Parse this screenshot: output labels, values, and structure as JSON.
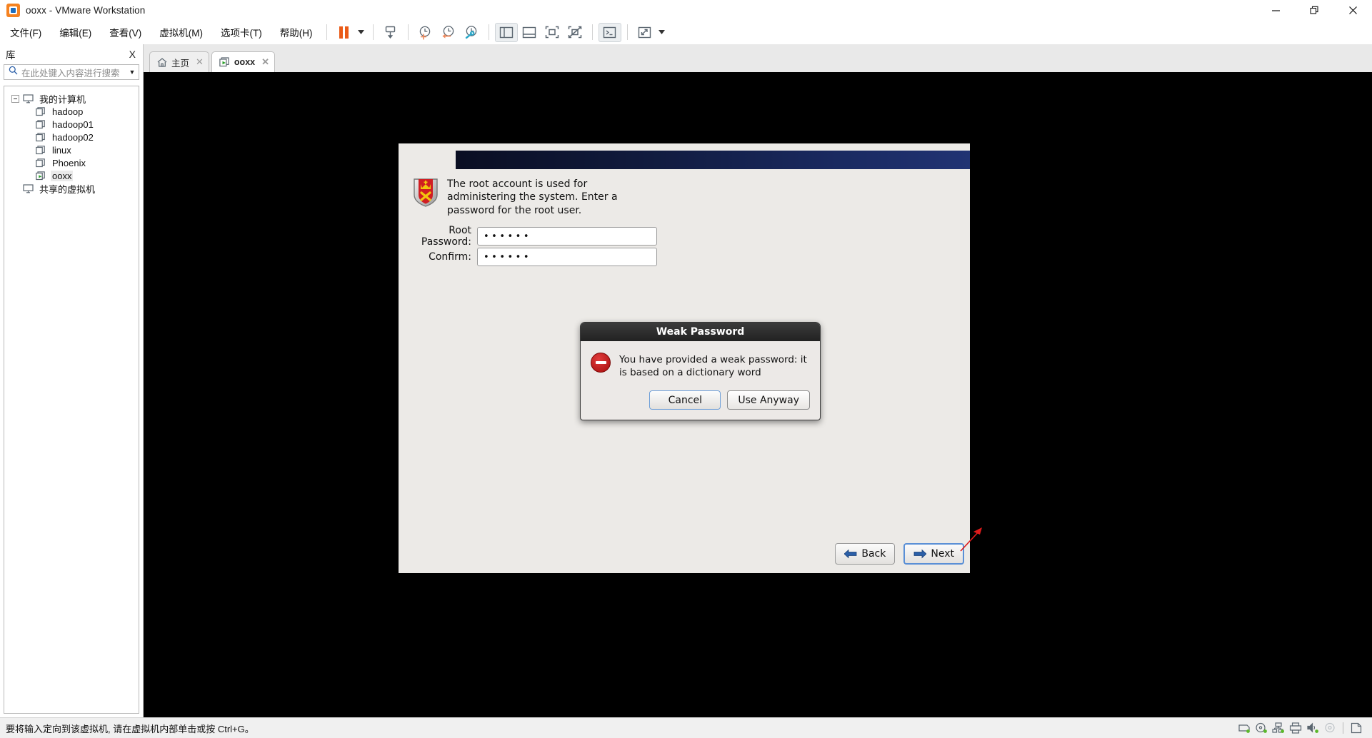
{
  "window": {
    "title": "ooxx - VMware Workstation",
    "app_icon": "vmware-logo-icon",
    "minimize": "minimize-icon",
    "restore": "restore-icon",
    "close": "close-icon"
  },
  "menubar": {
    "items": [
      {
        "label": "文件(F)",
        "text": "文件",
        "accel": "F"
      },
      {
        "label": "编辑(E)",
        "text": "编辑",
        "accel": "E"
      },
      {
        "label": "查看(V)",
        "text": "查看",
        "accel": "V"
      },
      {
        "label": "虚拟机(M)",
        "text": "虚拟机",
        "accel": "M"
      },
      {
        "label": "选项卡(T)",
        "text": "选项卡",
        "accel": "T"
      },
      {
        "label": "帮助(H)",
        "text": "帮助",
        "accel": "H"
      }
    ]
  },
  "toolbar": {
    "buttons": [
      {
        "name": "suspend-icon"
      },
      {
        "name": "power-dropdown-caret"
      },
      {
        "name": "send-ctrl-alt-del-icon"
      },
      {
        "name": "take-snapshot-icon"
      },
      {
        "name": "revert-snapshot-icon"
      },
      {
        "name": "manage-snapshots-icon"
      },
      {
        "name": "show-library-icon"
      },
      {
        "name": "show-thumbnail-bar-icon"
      },
      {
        "name": "show-console-view-icon"
      },
      {
        "name": "hide-console-view-icon"
      },
      {
        "name": "unity-mode-icon"
      },
      {
        "name": "full-screen-icon"
      },
      {
        "name": "full-screen-caret"
      }
    ]
  },
  "library": {
    "header": "库",
    "close_label": "X",
    "search": {
      "placeholder": "在此处键入内容进行搜索",
      "value": "",
      "icon": "search-icon",
      "dropdown": "chevron-down-icon"
    },
    "tree": [
      {
        "label": "我的计算机",
        "icon": "my-computer-icon",
        "level": 0,
        "expanded": true,
        "selected": false
      },
      {
        "label": "hadoop",
        "icon": "vm-icon",
        "level": 1,
        "selected": false
      },
      {
        "label": "hadoop01",
        "icon": "vm-icon",
        "level": 1,
        "selected": false
      },
      {
        "label": "hadoop02",
        "icon": "vm-icon",
        "level": 1,
        "selected": false
      },
      {
        "label": "linux",
        "icon": "vm-icon",
        "level": 1,
        "selected": false
      },
      {
        "label": "Phoenix",
        "icon": "vm-icon",
        "level": 1,
        "selected": false
      },
      {
        "label": "ooxx",
        "icon": "vm-running-icon",
        "level": 1,
        "selected": true
      },
      {
        "label": "共享的虚拟机",
        "icon": "shared-vms-icon",
        "level": 0,
        "selected": false
      }
    ]
  },
  "tabs": {
    "close_all_label": "X",
    "items": [
      {
        "label": "主页",
        "icon": "home-icon",
        "active": false,
        "close": "close-icon"
      },
      {
        "label": "ooxx",
        "icon": "vm-running-icon",
        "active": true,
        "close": "close-icon"
      }
    ]
  },
  "installer": {
    "banner": "",
    "note_icon": "root-shield-icon",
    "note": "The root account is used for administering the system.  Enter a password for the root user.",
    "fields": [
      {
        "label": "Root Password:",
        "value": "••••••",
        "masked_length": 6
      },
      {
        "label": "Confirm:",
        "value": "••••••",
        "masked_length": 6
      }
    ],
    "nav": {
      "back": {
        "label": "Back",
        "icon": "arrow-left-icon"
      },
      "next": {
        "label": "Next",
        "icon": "arrow-right-icon",
        "focused": true
      }
    }
  },
  "dialog": {
    "title": "Weak Password",
    "icon": "error-icon",
    "message": "You have provided a weak password: it is based on a dictionary word",
    "buttons": [
      {
        "label": "Cancel",
        "name": "cancel-button",
        "primary": false
      },
      {
        "label": "Use Anyway",
        "name": "use-anyway-button",
        "primary": true
      }
    ],
    "annotation": {
      "name": "red-arrow-annotation",
      "color": "#e01b1b",
      "points_to": "Use Anyway"
    }
  },
  "statusbar": {
    "message": "要将输入定向到该虚拟机, 请在虚拟机内部单击或按 Ctrl+G。",
    "devices": [
      {
        "name": "hard-disk-icon",
        "active": true
      },
      {
        "name": "cd-dvd-icon",
        "active": true
      },
      {
        "name": "network-adapter-icon",
        "active": true
      },
      {
        "name": "printer-icon",
        "active": false
      },
      {
        "name": "sound-card-icon",
        "active": true
      },
      {
        "name": "usb-icon",
        "active": false
      },
      {
        "name": "display-icon",
        "active": false
      }
    ]
  },
  "colors": {
    "accent_orange": "#f58220",
    "banner_dark": "#0a0e22",
    "banner_light": "#213373",
    "error_red": "#b01010",
    "active_green": "#5bb82b",
    "focus_blue": "#5a8fd6"
  }
}
